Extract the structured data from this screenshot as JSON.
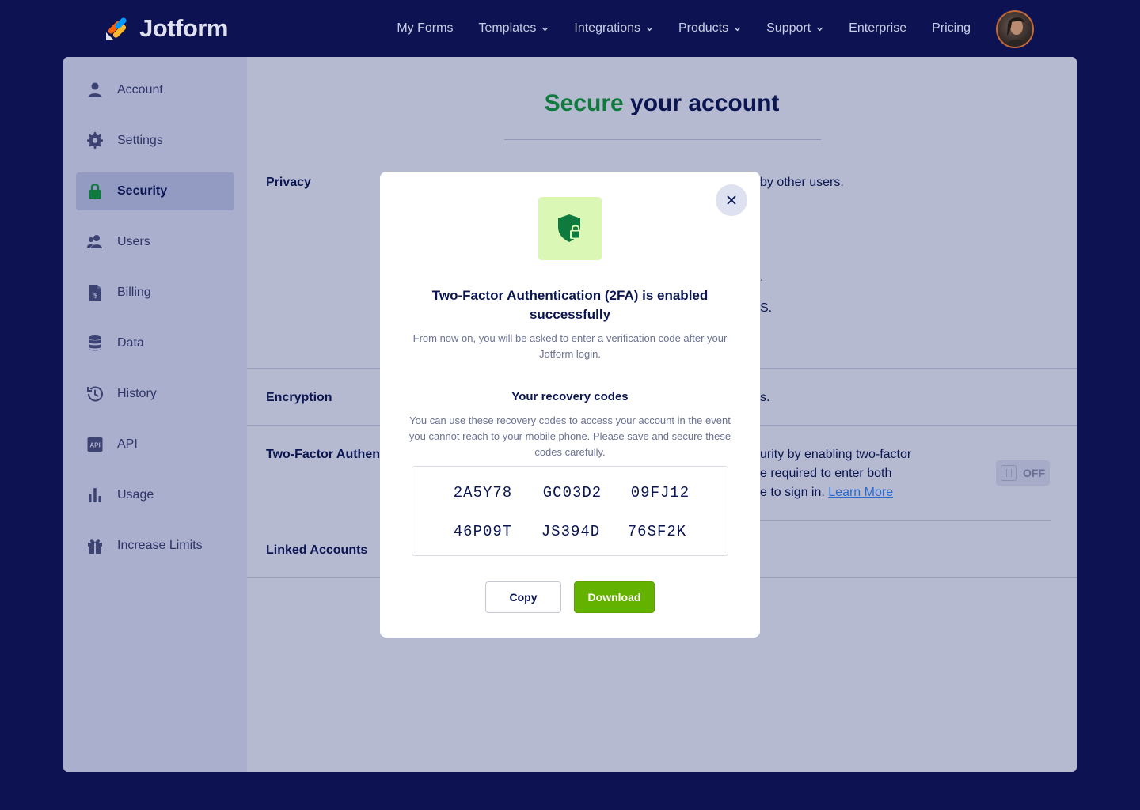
{
  "brand": {
    "name": "Jotform"
  },
  "nav": {
    "items": [
      {
        "label": "My Forms",
        "dropdown": false
      },
      {
        "label": "Templates",
        "dropdown": true
      },
      {
        "label": "Integrations",
        "dropdown": true
      },
      {
        "label": "Products",
        "dropdown": true
      },
      {
        "label": "Support",
        "dropdown": true
      },
      {
        "label": "Enterprise",
        "dropdown": false
      },
      {
        "label": "Pricing",
        "dropdown": false
      }
    ]
  },
  "sidebar": {
    "items": [
      {
        "label": "Account",
        "icon": "user-icon"
      },
      {
        "label": "Settings",
        "icon": "gear-icon"
      },
      {
        "label": "Security",
        "icon": "lock-icon",
        "active": true
      },
      {
        "label": "Users",
        "icon": "users-icon"
      },
      {
        "label": "Billing",
        "icon": "invoice-icon"
      },
      {
        "label": "Data",
        "icon": "database-icon"
      },
      {
        "label": "History",
        "icon": "history-icon"
      },
      {
        "label": "API",
        "icon": "api-icon"
      },
      {
        "label": "Usage",
        "icon": "bar-chart-icon"
      },
      {
        "label": "Increase Limits",
        "icon": "gift-icon"
      }
    ]
  },
  "page": {
    "title_accent": "Secure",
    "title_rest": " your account",
    "sections": {
      "privacy": {
        "label": "Privacy",
        "frag1": "by other users.",
        "frag2": ".",
        "frag3": "S."
      },
      "encryption": {
        "label": "Encryption",
        "frag": "s."
      },
      "two_factor": {
        "label": "Two-Factor Authent",
        "line1": "urity by enabling two-factor",
        "line2": "e required to enter both",
        "line3_prefix": "e to sign in. ",
        "learn_more": "Learn More",
        "toggle_label": "OFF"
      },
      "linked": {
        "label": "Linked Accounts"
      }
    }
  },
  "modal": {
    "title": "Two-Factor Authentication (2FA) is enabled successfully",
    "description": "From now on, you will be asked to enter a verification code after your Jotform login.",
    "codes_title": "Your recovery codes",
    "codes_description": "You can use these recovery codes to access your account in the event you cannot reach to your mobile phone. Please save and secure these codes carefully.",
    "codes": [
      "2A5Y78",
      "GC03D2",
      "09FJ12",
      "46P09T",
      "JS394D",
      "76SF2K"
    ],
    "copy_label": "Copy",
    "download_label": "Download",
    "colors": {
      "accent_green": "#64b200",
      "icon_bg": "#dbf7b5"
    }
  }
}
